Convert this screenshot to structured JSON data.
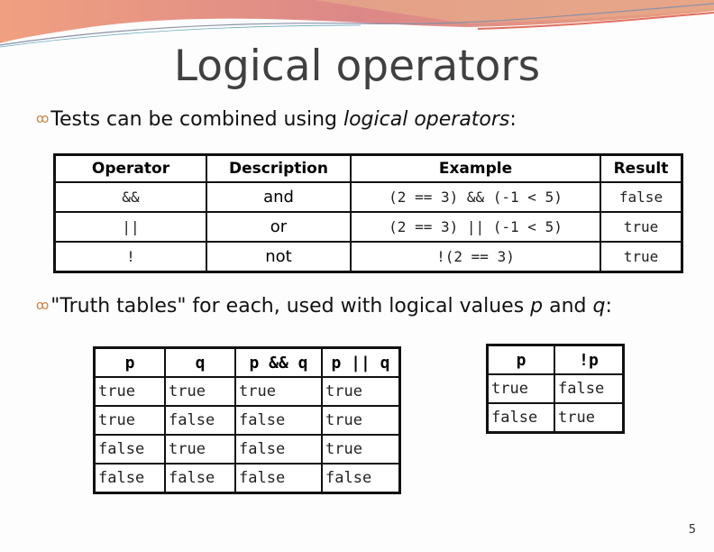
{
  "slide": {
    "title": "Logical operators",
    "page_number": "5",
    "bullet1": {
      "text": "Tests can be combined using ",
      "italic": "logical operators",
      "suffix": ":"
    },
    "bullet2": {
      "text": "\"Truth tables\" for each, used with logical values ",
      "p": "p",
      "and": " and ",
      "q": "q",
      "suffix": ":"
    }
  },
  "operators_table": {
    "headers": [
      "Operator",
      "Description",
      "Example",
      "Result"
    ],
    "rows": [
      [
        "&&",
        "and",
        "(2 == 3) && (-1 < 5)",
        "false"
      ],
      [
        "||",
        "or",
        "(2 == 3) || (-1 < 5)",
        "true"
      ],
      [
        "!",
        "not",
        "!(2 == 3)",
        "true"
      ]
    ]
  },
  "truth_table_binary": {
    "headers": [
      "p",
      "q",
      "p && q",
      "p || q"
    ],
    "rows": [
      [
        "true",
        "true",
        "true",
        "true"
      ],
      [
        "true",
        "false",
        "false",
        "true"
      ],
      [
        "false",
        "true",
        "false",
        "true"
      ],
      [
        "false",
        "false",
        "false",
        "false"
      ]
    ]
  },
  "truth_table_not": {
    "headers": [
      "p",
      "!p"
    ],
    "rows": [
      [
        "true",
        "false"
      ],
      [
        "false",
        "true"
      ]
    ]
  },
  "icons": {
    "bullet": "ornament-bullet-icon"
  }
}
